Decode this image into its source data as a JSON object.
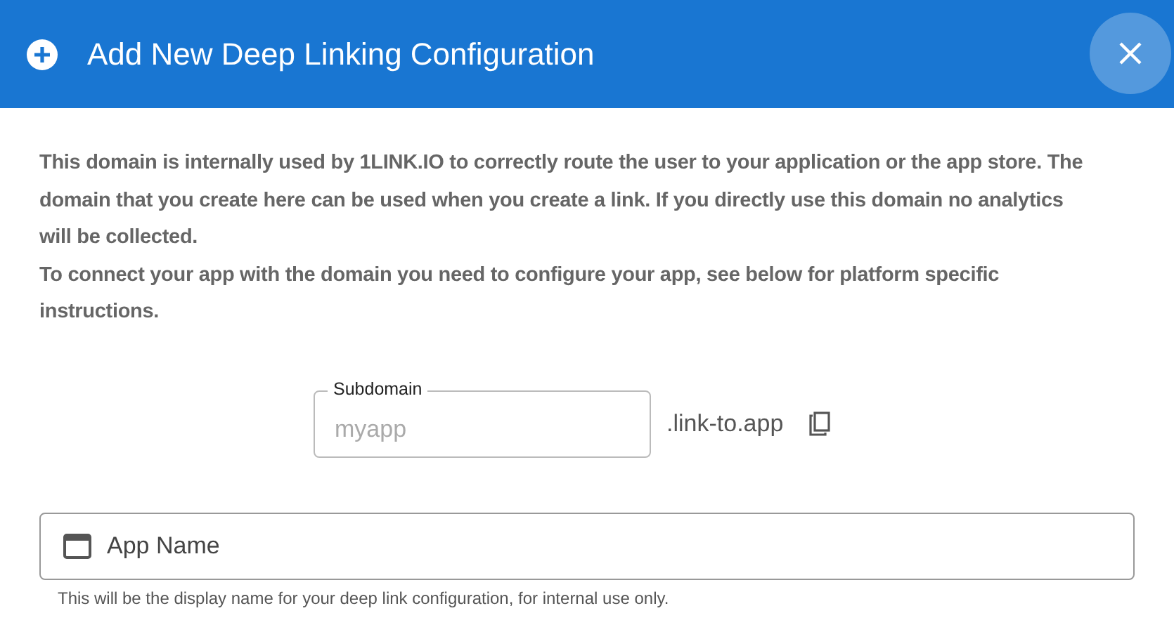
{
  "dialog": {
    "title": "Add New Deep Linking Configuration"
  },
  "description": [
    "This domain is internally used by 1LINK.IO to correctly route the user to your application or the app store. The domain that you create here can be used when you create a link. If you directly use this domain no analytics will be collected.",
    "To connect your app with the domain you need to configure your app, see below for platform specific instructions."
  ],
  "subdomain_field": {
    "label": "Subdomain",
    "placeholder": "myapp",
    "suffix": ".link-to.app"
  },
  "app_name_field": {
    "placeholder": "App Name",
    "hint": "This will be the display name for your deep link configuration, for internal use only."
  }
}
